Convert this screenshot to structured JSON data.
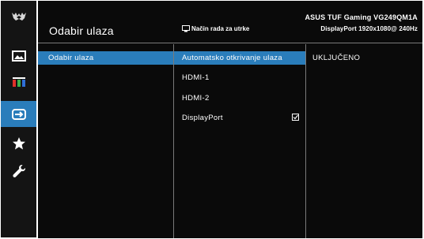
{
  "header": {
    "title": "Odabir ulaza",
    "model": "ASUS TUF Gaming  VG249QM1A",
    "mode_text": "Način rada za utrke",
    "source_text": "DisplayPort  1920x1080@ 240Hz"
  },
  "sidebar": {
    "items": [
      {
        "icon": "tuf-logo-icon",
        "active": false
      },
      {
        "icon": "image-icon",
        "active": false
      },
      {
        "icon": "color-icon",
        "active": false
      },
      {
        "icon": "input-select-icon",
        "active": true
      },
      {
        "icon": "star-icon",
        "active": false
      },
      {
        "icon": "wrench-icon",
        "active": false
      }
    ]
  },
  "menu": {
    "level1": [
      {
        "label": "Odabir ulaza",
        "selected": true
      }
    ],
    "level2": [
      {
        "label": "Automatsko otkrivanje ulaza",
        "selected": true
      },
      {
        "label": "HDMI-1",
        "selected": false
      },
      {
        "label": "HDMI-2",
        "selected": false
      },
      {
        "label": "DisplayPort",
        "selected": false,
        "checked": true
      }
    ],
    "level3": [
      {
        "label": "UKLJUČENO",
        "selected": false
      }
    ]
  },
  "colors": {
    "accent": "#2a7dbb",
    "background": "#0a0a0a",
    "sidebar": "#141414",
    "divider": "#7a7a7a"
  }
}
